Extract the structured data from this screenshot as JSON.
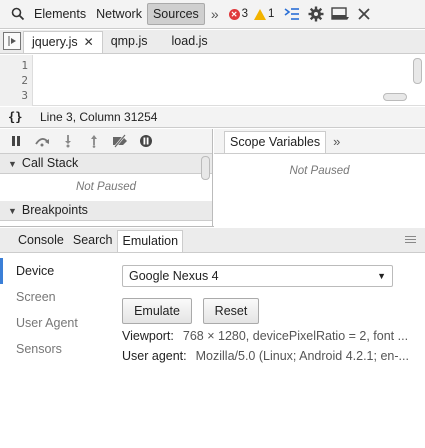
{
  "toolbar": {
    "tabs": [
      "Elements",
      "Network",
      "Sources"
    ],
    "active_tab": "Sources",
    "more": "»",
    "errors_count": "3",
    "warnings_count": "1"
  },
  "file_tabs": {
    "tabs": [
      {
        "label": "jquery.js",
        "close": "✕"
      },
      {
        "label": "qmp.js"
      },
      {
        "label": "load.js"
      }
    ]
  },
  "editor": {
    "line_numbers": [
      "1",
      "2",
      "3"
    ]
  },
  "status": {
    "pretty_print": "{}",
    "cursor": "Line 3, Column 31254"
  },
  "debugger": {
    "call_stack_label": "Call Stack",
    "call_stack_status": "Not Paused",
    "breakpoints_label": "Breakpoints",
    "scope_tab": "Scope Variables",
    "scope_more": "»",
    "scope_status": "Not Paused"
  },
  "drawer": {
    "tabs": [
      "Console",
      "Search",
      "Emulation"
    ],
    "active_tab": "Emulation",
    "side_items": [
      "Device",
      "Screen",
      "User Agent",
      "Sensors"
    ],
    "active_side": "Device",
    "device_select": "Google Nexus 4",
    "emulate_button": "Emulate",
    "reset_button": "Reset",
    "viewport_label": "Viewport:",
    "viewport_value": "768 × 1280, devicePixelRatio = 2, font ...",
    "ua_label": "User agent:",
    "ua_value": "Mozilla/5.0 (Linux; Android 4.2.1; en-..."
  },
  "colors": {
    "accent": "#3b7fd7",
    "error": "#e0383b",
    "warning": "#f2b300"
  }
}
